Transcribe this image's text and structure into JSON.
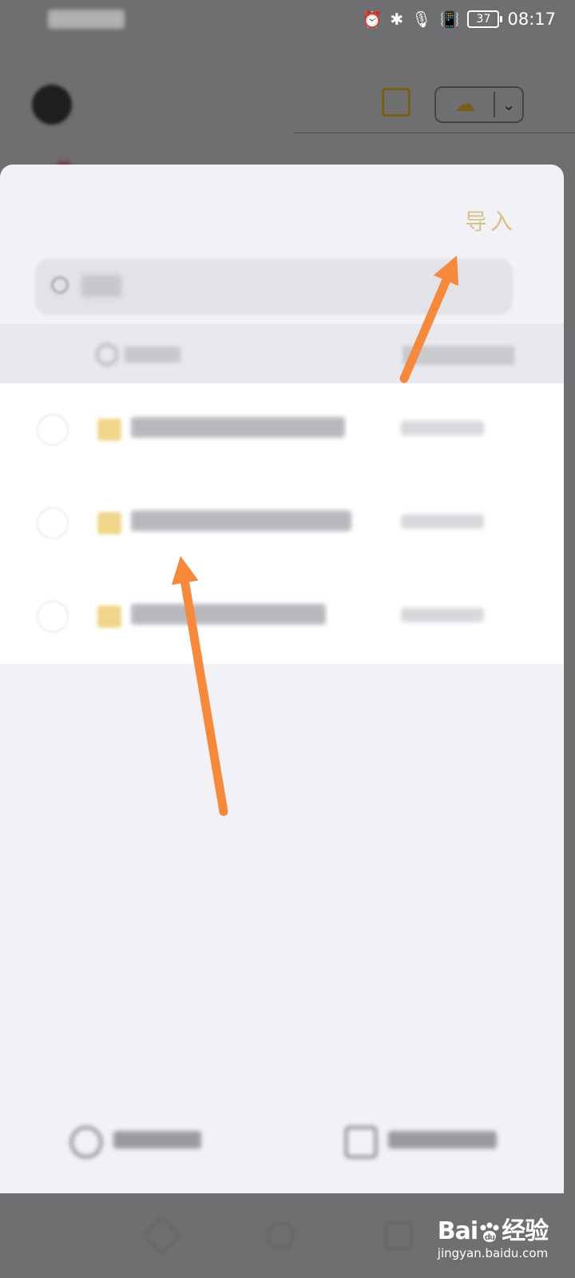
{
  "status_bar": {
    "battery": "37",
    "time": "08:17",
    "icons": [
      "alarm-icon",
      "bluetooth-icon",
      "microphone-icon",
      "vibrate-icon",
      "battery-icon"
    ]
  },
  "app_header": {
    "sort_options": [
      "",
      "",
      "名称"
    ],
    "sort_selected": "名称",
    "accent_color": "#7a5d16"
  },
  "sheet": {
    "import_label": "导入",
    "accent_color": "#d8c289",
    "file_icon_color": "#f0d68a"
  },
  "watermark": {
    "brand": "Bai",
    "brand_suffix": "经验",
    "url": "jingyan.baidu.com"
  },
  "annotation": {
    "arrow_color": "#f6893b"
  }
}
